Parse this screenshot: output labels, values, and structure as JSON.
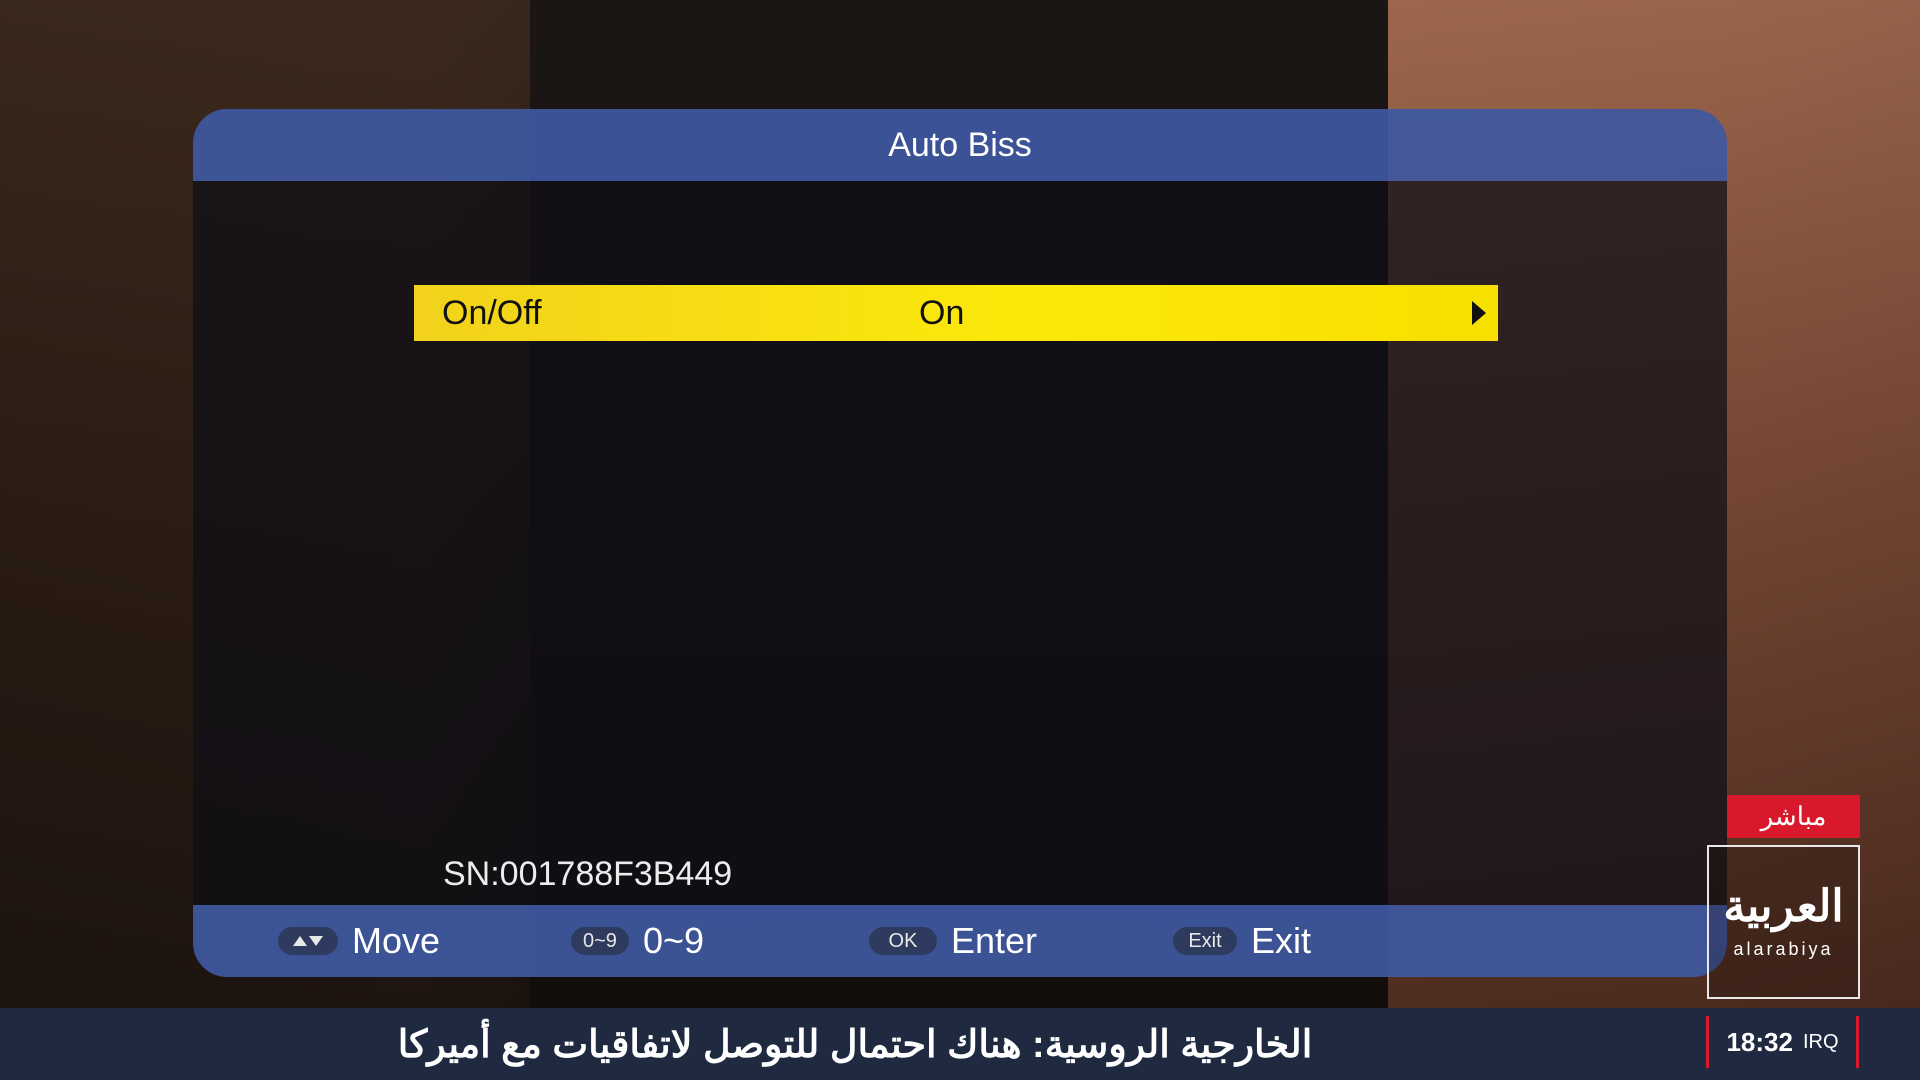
{
  "menu": {
    "title": "Auto Biss",
    "rows": [
      {
        "label": "On/Off",
        "value": "On"
      }
    ],
    "serial": "SN:001788F3B449",
    "highlight_color": "#f8e000",
    "header_color": "#3e58a0"
  },
  "footer": {
    "hints": [
      {
        "key": "",
        "key_icon": "up-down-arrows-icon",
        "label": "Move"
      },
      {
        "key": "0~9",
        "label": "0~9"
      },
      {
        "key": "OK",
        "label": "Enter"
      },
      {
        "key": "Exit",
        "label": "Exit"
      }
    ]
  },
  "channel": {
    "live_badge": "مباشر",
    "logo_arabic": "العربية",
    "logo_latin": "alarabiya",
    "accent_color": "#d8192c"
  },
  "ticker": {
    "text": "الخارجية الروسية: هناك احتمال للتوصل لاتفاقيات مع أميركا",
    "time": "18:32",
    "timezone": "IRQ"
  }
}
